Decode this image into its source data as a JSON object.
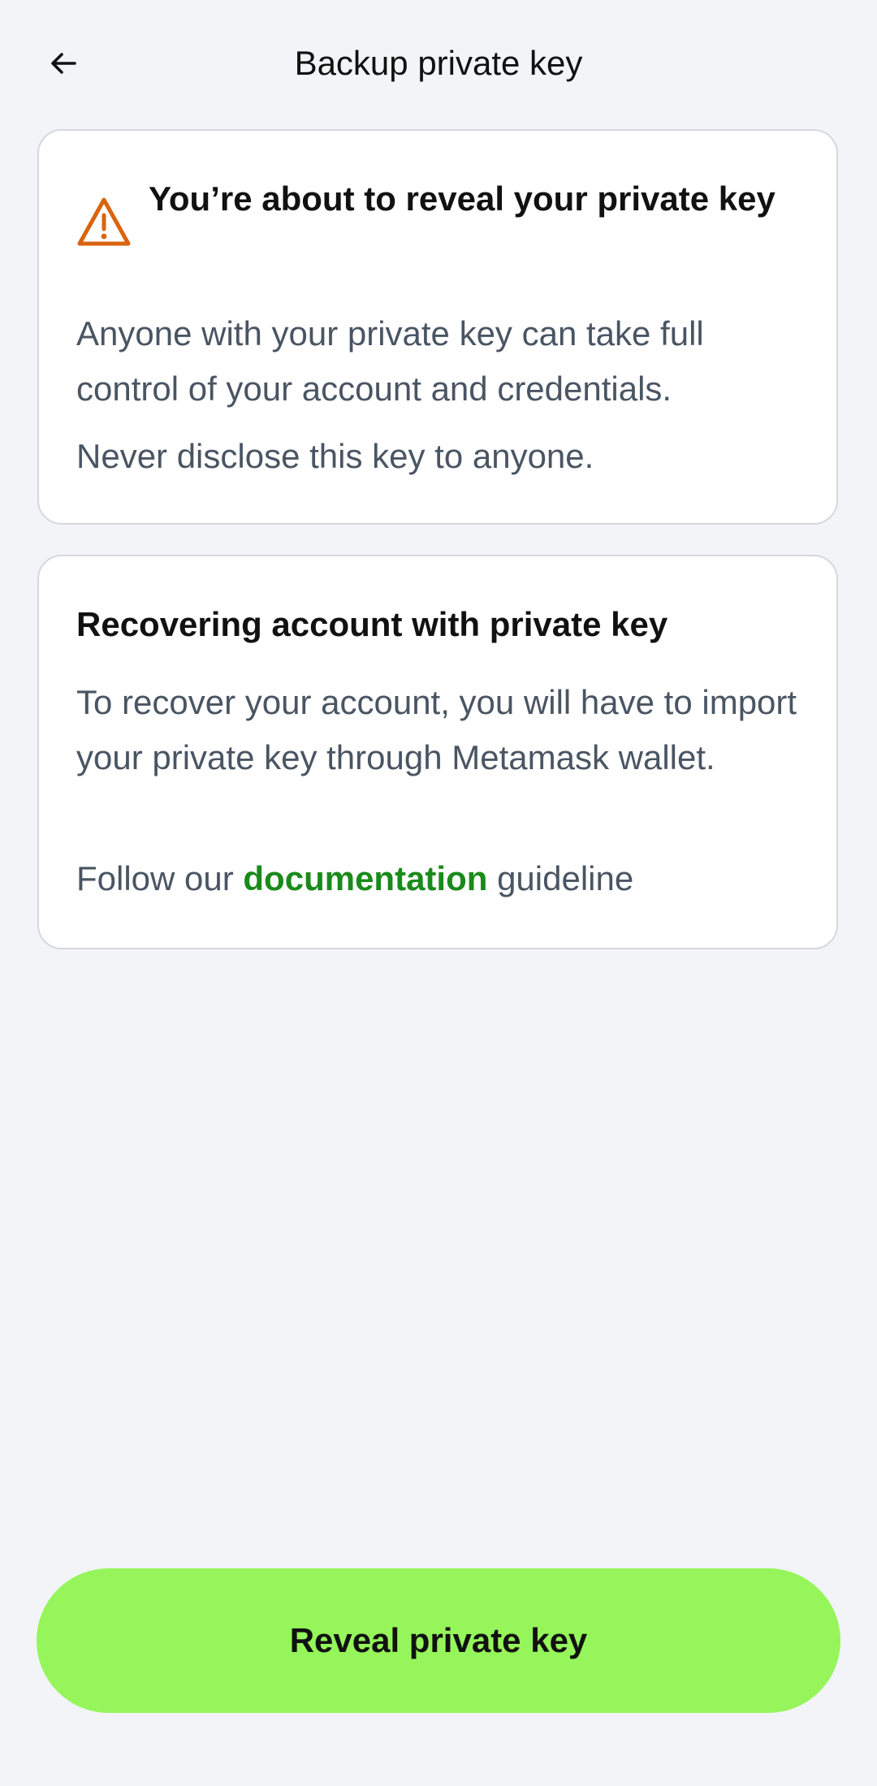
{
  "header": {
    "title": "Backup private key",
    "back_icon": "arrow-left-icon"
  },
  "warning_card": {
    "icon": "warning-triangle-icon",
    "icon_color": "#d9640e",
    "title": "You’re about to reveal your private key",
    "body_1": "Anyone with your private key can take full control of your account and credentials.",
    "body_2": "Never disclose this key to anyone."
  },
  "recover_card": {
    "title": "Recovering account with private key",
    "body_1": "To recover your account, you will have to import your private key through Metamask wallet.",
    "follow_prefix": "Follow our ",
    "link_label": "documentation",
    "follow_suffix": " guideline"
  },
  "actions": {
    "reveal_label": "Reveal private key",
    "reveal_color": "#95f55a"
  }
}
